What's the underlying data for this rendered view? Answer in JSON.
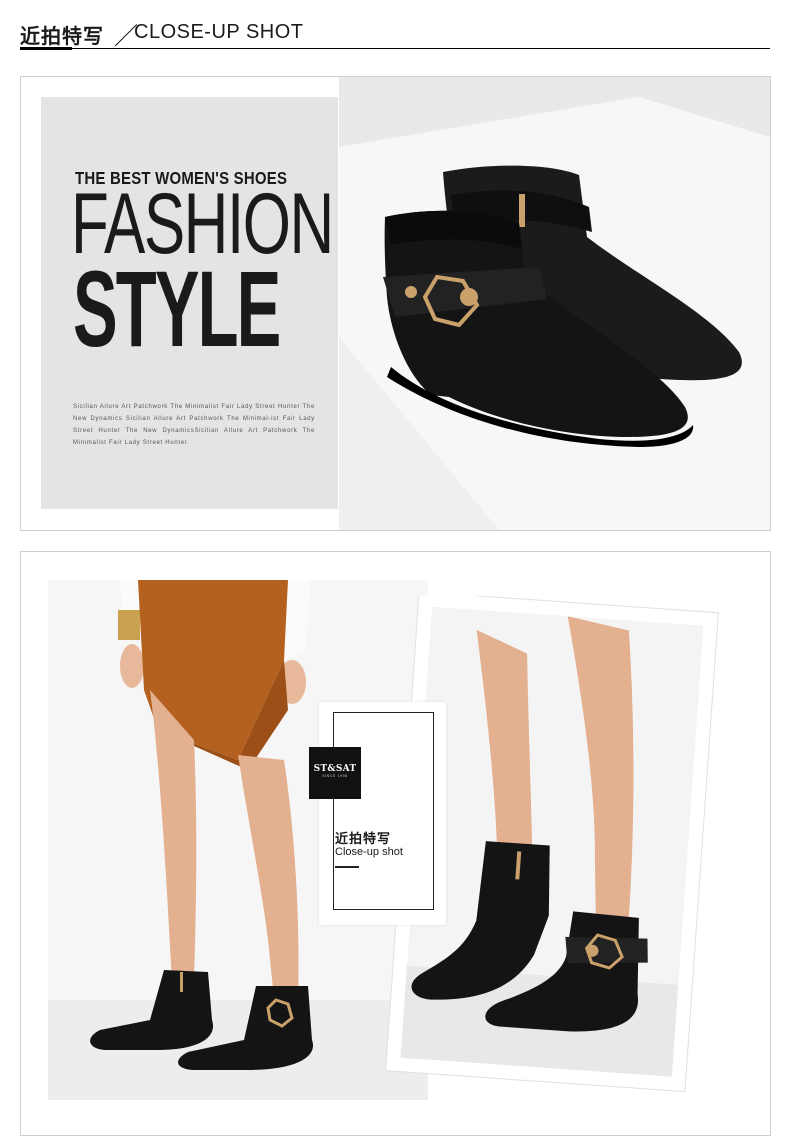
{
  "header": {
    "title_cn": "近拍特写",
    "separator": "／",
    "title_en": "CLOSE-UP SHOT"
  },
  "hero": {
    "tagline": "THE BEST WOMEN'S SHOES",
    "headline_1": "FASHION",
    "headline_2": "STYLE",
    "body": "Sicilian Allure  Art Patchwork The Minimalist  Fair Lady Street Hunter The New Dynamics Sicilian Allure  Art Patchwork The Minimal-ist  Fair Lady Street Hunter The New DynamicsSicilian Allure  Art Patchwork The Minimalist  Fair Lady Street Hunter."
  },
  "brand_card": {
    "logo_text": "ST&SAT",
    "logo_since": "SINCE 1998",
    "title_cn": "近拍特写",
    "title_en": "Close-up shot"
  },
  "icons": [
    "ankle-boots-product-photo",
    "model-wearing-boots-photo",
    "boots-closeup-photo"
  ],
  "colors": {
    "text": "#1a1a1a",
    "card_gray": "#e4e4e4",
    "skirt": "#b4611f",
    "leather": "#141414",
    "gold": "#caa16a"
  }
}
